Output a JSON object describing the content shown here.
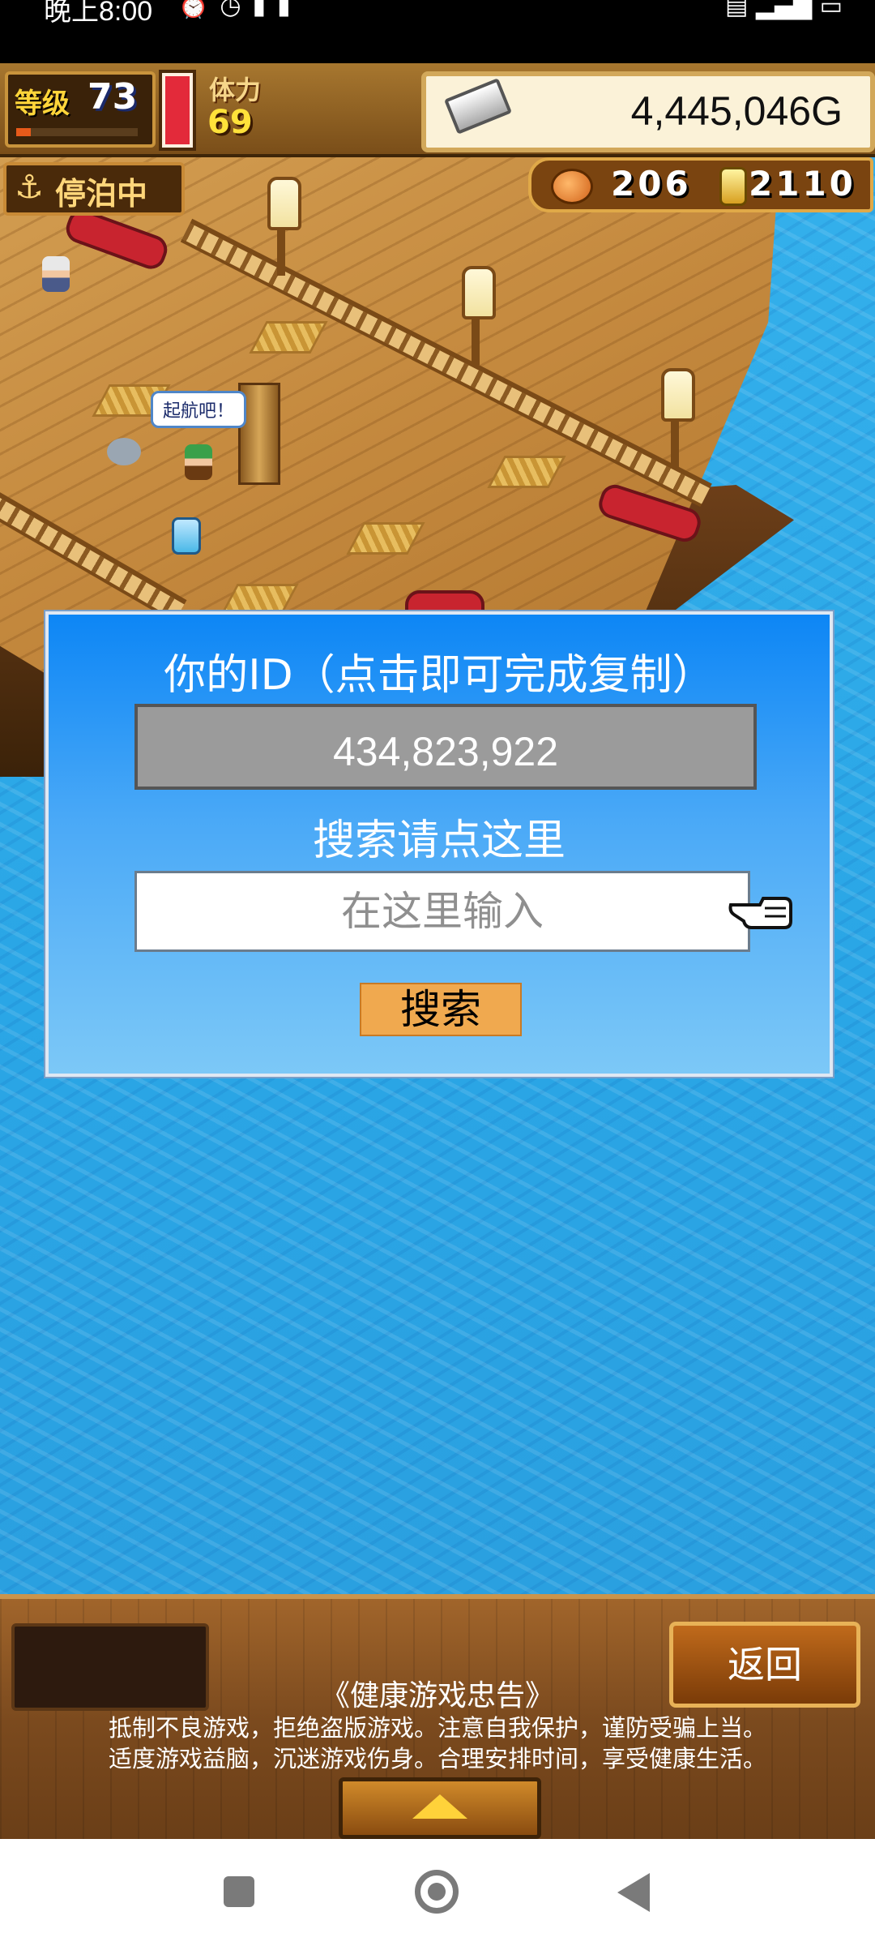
{
  "status_bar": {
    "time": "晚上8:00"
  },
  "hud": {
    "level_label": "等级",
    "level_value": "73",
    "stamina_label": "体力",
    "stamina_value": "69",
    "gold": "4,445,046G",
    "anchor_status": "停泊中",
    "resource_a": "206",
    "resource_b": "2110"
  },
  "scene": {
    "speech_bubble": "起航吧！"
  },
  "dialog": {
    "id_title": "你的ID（点击即可完成复制）",
    "id_value": "434,823,922",
    "search_title": "搜索请点这里",
    "search_placeholder": "在这里输入",
    "search_button": "搜索"
  },
  "bottom": {
    "back_button": "返回",
    "notice_title": "《健康游戏忠告》",
    "notice_line1": "抵制不良游戏，拒绝盗版游戏。注意自我保护，谨防受骗上当。",
    "notice_line2": "适度游戏益脑，沉迷游戏伤身。合理安排时间，享受健康生活。"
  },
  "icons": {
    "anchor": "anchor-icon",
    "gold": "silver-bar-icon",
    "pointer": "pointing-hand-icon"
  }
}
